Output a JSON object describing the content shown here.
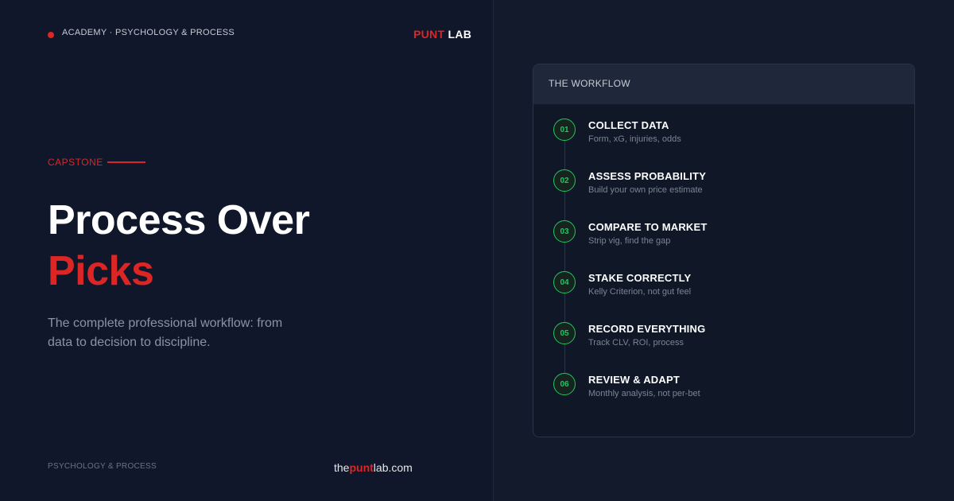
{
  "header": {
    "breadcrumb": "ACADEMY · PSYCHOLOGY & PROCESS",
    "brand_part1": "PUNT",
    "brand_part2": "LAB"
  },
  "hero": {
    "eyebrow": "CAPSTONE",
    "title_line1": "Process Over",
    "title_line2": "Picks",
    "lede": "The complete professional workflow: from data to decision to discipline."
  },
  "footer": {
    "category": "PSYCHOLOGY & PROCESS",
    "domain_prefix": "the",
    "domain_brand": "punt",
    "domain_suffix": "lab.com"
  },
  "workflow": {
    "title": "THE WORKFLOW",
    "steps": [
      {
        "num": "01",
        "title": "COLLECT DATA",
        "sub": "Form, xG, injuries, odds"
      },
      {
        "num": "02",
        "title": "ASSESS PROBABILITY",
        "sub": "Build your own price estimate"
      },
      {
        "num": "03",
        "title": "COMPARE TO MARKET",
        "sub": "Strip vig, find the gap"
      },
      {
        "num": "04",
        "title": "STAKE CORRECTLY",
        "sub": "Kelly Criterion, not gut feel"
      },
      {
        "num": "05",
        "title": "RECORD EVERYTHING",
        "sub": "Track CLV, ROI, process"
      },
      {
        "num": "06",
        "title": "REVIEW & ADAPT",
        "sub": "Monthly analysis, not per-bet"
      }
    ]
  },
  "colors": {
    "accent_red": "#dc2626",
    "accent_green": "#22c55e",
    "background": "#10172a"
  }
}
